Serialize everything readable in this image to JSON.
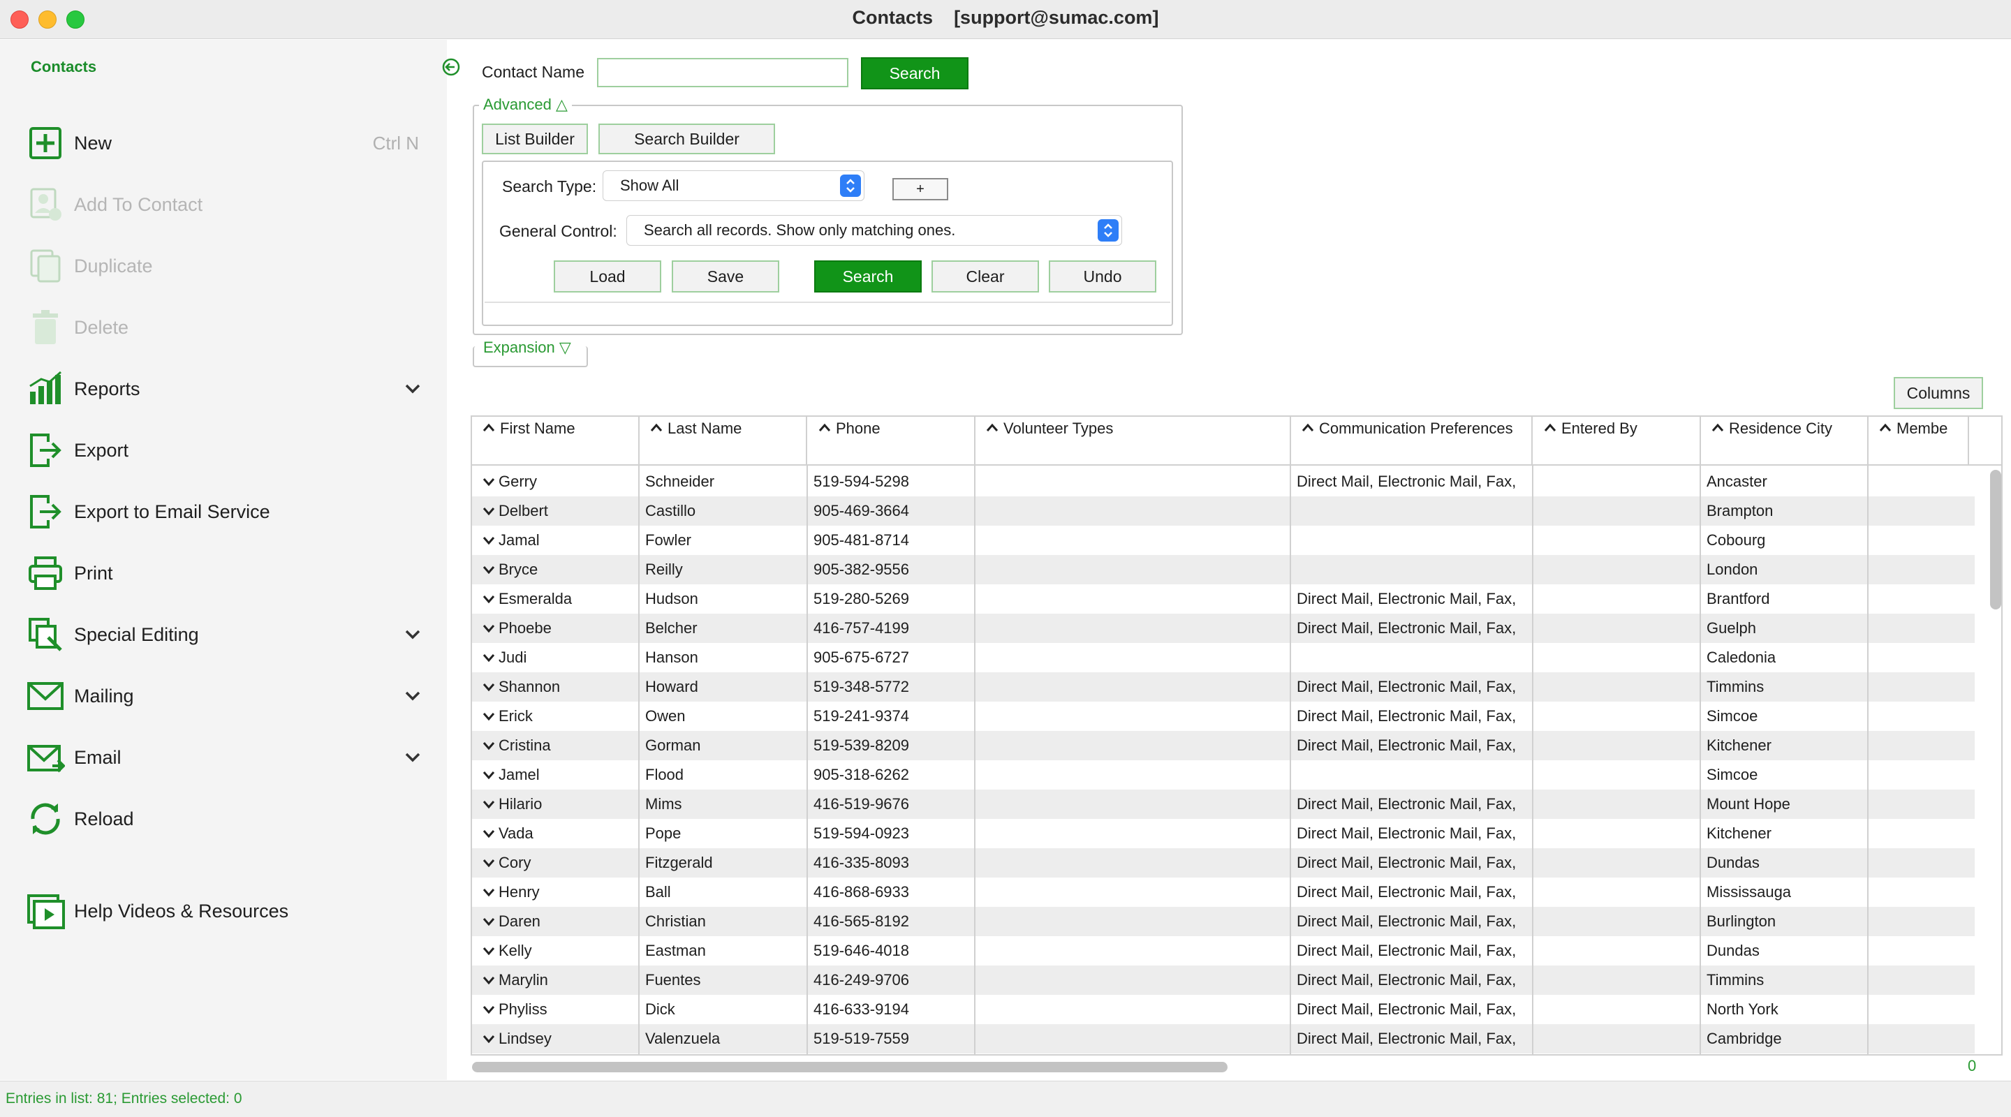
{
  "window": {
    "title": "Contacts    [support@sumac.com]"
  },
  "sidebar": {
    "title": "Contacts",
    "items": [
      {
        "label": "New",
        "shortcut": "Ctrl N",
        "icon": "plus-box-icon",
        "enabled": true
      },
      {
        "label": "Add To Contact",
        "icon": "add-contact-icon",
        "enabled": false
      },
      {
        "label": "Duplicate",
        "icon": "duplicate-icon",
        "enabled": false
      },
      {
        "label": "Delete",
        "icon": "trash-icon",
        "enabled": false
      },
      {
        "label": "Reports",
        "icon": "bar-chart-icon",
        "enabled": true,
        "expandable": true
      },
      {
        "label": "Export",
        "icon": "export-icon",
        "enabled": true
      },
      {
        "label": "Export to Email Service",
        "icon": "export-email-icon",
        "enabled": true
      },
      {
        "label": "Print",
        "icon": "printer-icon",
        "enabled": true
      },
      {
        "label": "Special Editing",
        "icon": "special-editing-icon",
        "enabled": true,
        "expandable": true
      },
      {
        "label": "Mailing",
        "icon": "mail-icon",
        "enabled": true,
        "expandable": true
      },
      {
        "label": "Email",
        "icon": "email-icon",
        "enabled": true,
        "expandable": true
      },
      {
        "label": "Reload",
        "icon": "reload-icon",
        "enabled": true
      },
      {
        "label": "Help Videos & Resources",
        "icon": "video-help-icon",
        "enabled": true
      }
    ]
  },
  "search": {
    "contact_name_label": "Contact Name",
    "contact_name_value": "",
    "search_button": "Search"
  },
  "advanced": {
    "legend": "Advanced △",
    "list_builder": "List Builder",
    "search_builder": "Search Builder",
    "search_type_label": "Search Type:",
    "search_type_value": "Show All",
    "add_button": "+",
    "general_control_label": "General Control:",
    "general_control_value": "Search all records. Show only matching ones.",
    "buttons": {
      "load": "Load",
      "save": "Save",
      "search": "Search",
      "clear": "Clear",
      "undo": "Undo"
    }
  },
  "expansion": {
    "legend": "Expansion ▽"
  },
  "columns_button": "Columns",
  "table": {
    "columns": [
      "First Name",
      "Last Name",
      "Phone",
      "Volunteer Types",
      "Communication Preferences",
      "Entered By",
      "Residence City",
      "Membe"
    ],
    "rows": [
      [
        "Gerry",
        "Schneider",
        "519-594-5298",
        "",
        "Direct Mail, Electronic Mail, Fax,",
        "",
        "Ancaster",
        ""
      ],
      [
        "Delbert",
        "Castillo",
        "905-469-3664",
        "",
        "",
        "",
        "Brampton",
        ""
      ],
      [
        "Jamal",
        "Fowler",
        "905-481-8714",
        "",
        "",
        "",
        "Cobourg",
        ""
      ],
      [
        "Bryce",
        "Reilly",
        "905-382-9556",
        "",
        "",
        "",
        "London",
        ""
      ],
      [
        "Esmeralda",
        "Hudson",
        "519-280-5269",
        "",
        "Direct Mail, Electronic Mail, Fax,",
        "",
        "Brantford",
        ""
      ],
      [
        "Phoebe",
        "Belcher",
        "416-757-4199",
        "",
        "Direct Mail, Electronic Mail, Fax,",
        "",
        "Guelph",
        ""
      ],
      [
        "Judi",
        "Hanson",
        "905-675-6727",
        "",
        "",
        "",
        "Caledonia",
        ""
      ],
      [
        "Shannon",
        "Howard",
        "519-348-5772",
        "",
        "Direct Mail, Electronic Mail, Fax,",
        "",
        "Timmins",
        ""
      ],
      [
        "Erick",
        "Owen",
        "519-241-9374",
        "",
        "Direct Mail, Electronic Mail, Fax,",
        "",
        "Simcoe",
        ""
      ],
      [
        "Cristina",
        "Gorman",
        "519-539-8209",
        "",
        "Direct Mail, Electronic Mail, Fax,",
        "",
        "Kitchener",
        ""
      ],
      [
        "Jamel",
        "Flood",
        "905-318-6262",
        "",
        "",
        "",
        "Simcoe",
        ""
      ],
      [
        "Hilario",
        "Mims",
        "416-519-9676",
        "",
        "Direct Mail, Electronic Mail, Fax,",
        "",
        "Mount Hope",
        ""
      ],
      [
        "Vada",
        "Pope",
        "519-594-0923",
        "",
        "Direct Mail, Electronic Mail, Fax,",
        "",
        "Kitchener",
        ""
      ],
      [
        "Cory",
        "Fitzgerald",
        "416-335-8093",
        "",
        "Direct Mail, Electronic Mail, Fax,",
        "",
        "Dundas",
        ""
      ],
      [
        "Henry",
        "Ball",
        "416-868-6933",
        "",
        "Direct Mail, Electronic Mail, Fax,",
        "",
        "Mississauga",
        ""
      ],
      [
        "Daren",
        "Christian",
        "416-565-8192",
        "",
        "Direct Mail, Electronic Mail, Fax,",
        "",
        "Burlington",
        ""
      ],
      [
        "Kelly",
        "Eastman",
        "519-646-4018",
        "",
        "Direct Mail, Electronic Mail, Fax,",
        "",
        "Dundas",
        ""
      ],
      [
        "Marylin",
        "Fuentes",
        "416-249-9706",
        "",
        "Direct Mail, Electronic Mail, Fax,",
        "",
        "Timmins",
        ""
      ],
      [
        "Phyliss",
        "Dick",
        "416-633-9194",
        "",
        "Direct Mail, Electronic Mail, Fax,",
        "",
        "North York",
        ""
      ],
      [
        "Lindsey",
        "Valenzuela",
        "519-519-7559",
        "",
        "Direct Mail, Electronic Mail, Fax,",
        "",
        "Cambridge",
        ""
      ]
    ]
  },
  "corner_count": "0",
  "status": "Entries in list: 81; Entries selected: 0",
  "colors": {
    "accent_green": "#119418",
    "label_green": "#2a9a33",
    "select_blue": "#2e7ef7"
  }
}
